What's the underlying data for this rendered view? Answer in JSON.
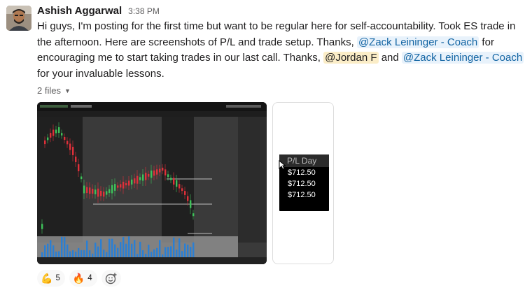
{
  "message": {
    "author": "Ashish Aggarwal",
    "time": "3:38 PM",
    "text": [
      {
        "t": "Hi guys, I'm posting for the first time but want to be regular here for self-accountability. Took ES trade in the afternoon. Here are screenshots of P/L and trade setup. Thanks, "
      },
      {
        "t": "@Zack Leininger - Coach",
        "mention": true
      },
      {
        "t": " for encouraging me to start taking trades in our last call. Thanks, "
      },
      {
        "t": "@Jordan F",
        "mention": true,
        "self": true
      },
      {
        "t": " and "
      },
      {
        "t": "@Zack Leininger - Coach",
        "mention": true
      },
      {
        "t": " for your invaluable lessons."
      }
    ]
  },
  "files": {
    "toggle_label": "2 files",
    "pl_card": {
      "header": "P/L Day",
      "rows": [
        "$712.50",
        "$712.50",
        "$712.50"
      ]
    }
  },
  "reactions": [
    {
      "emoji": "💪",
      "icon": "flexed-biceps-icon",
      "count": "5"
    },
    {
      "emoji": "🔥",
      "icon": "fire-icon",
      "count": "4"
    }
  ],
  "colors": {
    "mention_bg": "#e8f2fb",
    "mention_fg": "#1264a3",
    "self_mention_bg": "#fbedc7",
    "candle_up": "#3ec25a",
    "candle_down": "#e0303a"
  }
}
